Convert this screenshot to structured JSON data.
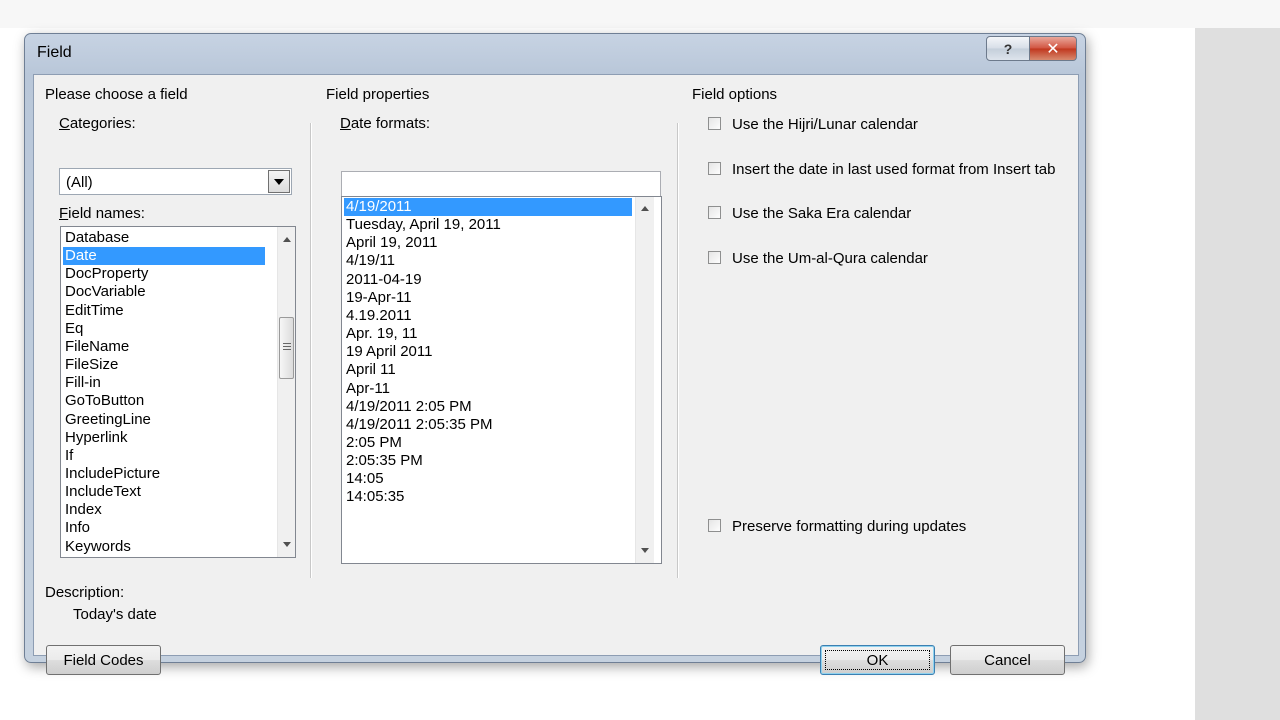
{
  "dialog": {
    "title": "Field",
    "help_label": "?",
    "close_label": "✕"
  },
  "left": {
    "group_title": "Please choose a field",
    "categories_label": "Categories:",
    "categories_value": "(All)",
    "field_names_label": "Field names:",
    "field_names": [
      "Database",
      "Date",
      "DocProperty",
      "DocVariable",
      "EditTime",
      "Eq",
      "FileName",
      "FileSize",
      "Fill-in",
      "GoToButton",
      "GreetingLine",
      "Hyperlink",
      "If",
      "IncludePicture",
      "IncludeText",
      "Index",
      "Info",
      "Keywords"
    ],
    "selected_field": "Date",
    "description_label": "Description:",
    "description_text": "Today's date",
    "field_codes_button": "Field Codes"
  },
  "middle": {
    "group_title": "Field properties",
    "date_formats_label": "Date formats:",
    "date_format_input": "",
    "date_formats": [
      "4/19/2011",
      "Tuesday, April 19, 2011",
      "April 19, 2011",
      "4/19/11",
      "2011-04-19",
      "19-Apr-11",
      "4.19.2011",
      "Apr. 19, 11",
      "19 April 2011",
      "April 11",
      "Apr-11",
      "4/19/2011 2:05 PM",
      "4/19/2011 2:05:35 PM",
      "2:05 PM",
      "2:05:35 PM",
      "14:05",
      "14:05:35"
    ],
    "selected_format": "4/19/2011"
  },
  "right": {
    "group_title": "Field options",
    "options": [
      {
        "label": "Use the Hijri/Lunar calendar",
        "checked": false
      },
      {
        "label": "Insert the date in last used format from Insert tab",
        "checked": false
      },
      {
        "label": "Use the Saka Era calendar",
        "checked": false
      },
      {
        "label": "Use the Um-al-Qura calendar",
        "checked": false
      }
    ],
    "preserve_label": "Preserve formatting during updates",
    "preserve_checked": false
  },
  "buttons": {
    "ok": "OK",
    "cancel": "Cancel"
  }
}
